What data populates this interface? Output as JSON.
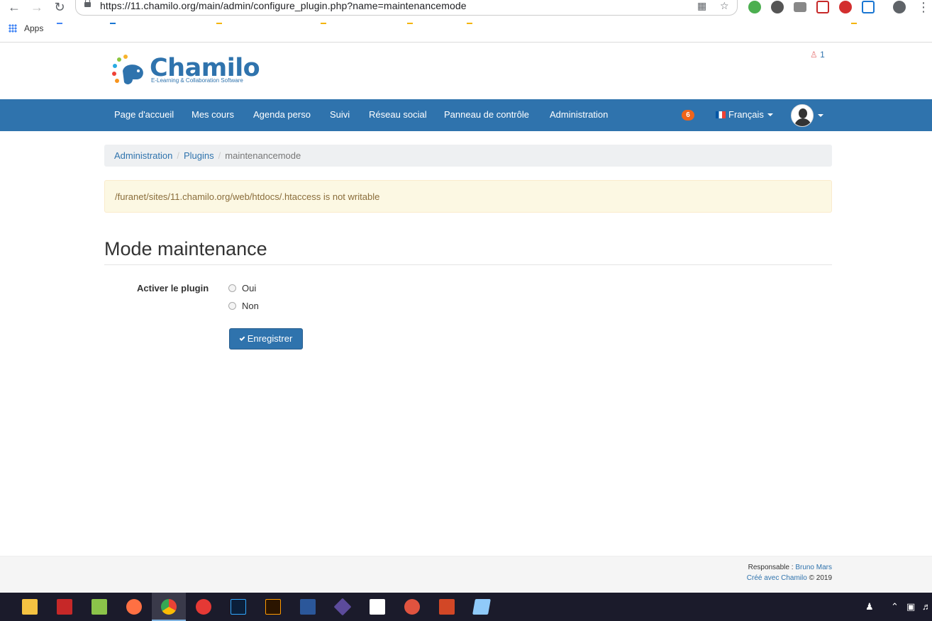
{
  "browser": {
    "url": "https://11.chamilo.org/main/admin/configure_plugin.php?name=maintenancemode",
    "apps_label": "Apps"
  },
  "header": {
    "logo_text": "Chamilo",
    "logo_subtitle": "E-Learning & Collaboration Software",
    "online_users": "1"
  },
  "nav": {
    "items": [
      "Page d'accueil",
      "Mes cours",
      "Agenda perso",
      "Suivi",
      "Réseau social",
      "Panneau de contrôle",
      "Administration"
    ],
    "notifications": "6",
    "language": "Français"
  },
  "breadcrumb": {
    "items": [
      "Administration",
      "Plugins"
    ],
    "current": "maintenancemode"
  },
  "alert": {
    "message": "/furanet/sites/11.chamilo.org/web/htdocs/.htaccess is not writable"
  },
  "page": {
    "title": "Mode maintenance"
  },
  "form": {
    "field_label": "Activer le plugin",
    "options": [
      "Oui",
      "Non"
    ],
    "selected": null,
    "submit_label": "Enregistrer"
  },
  "footer": {
    "manager_label": "Responsable : ",
    "manager_name": "Bruno Mars",
    "powered_link": "Créé avec Chamilo",
    "copyright": " © 2019"
  },
  "colors": {
    "brand": "#2f73ad",
    "badge": "#f0641a",
    "alert_bg": "#fcf8e3",
    "alert_text": "#8a6d3b"
  }
}
